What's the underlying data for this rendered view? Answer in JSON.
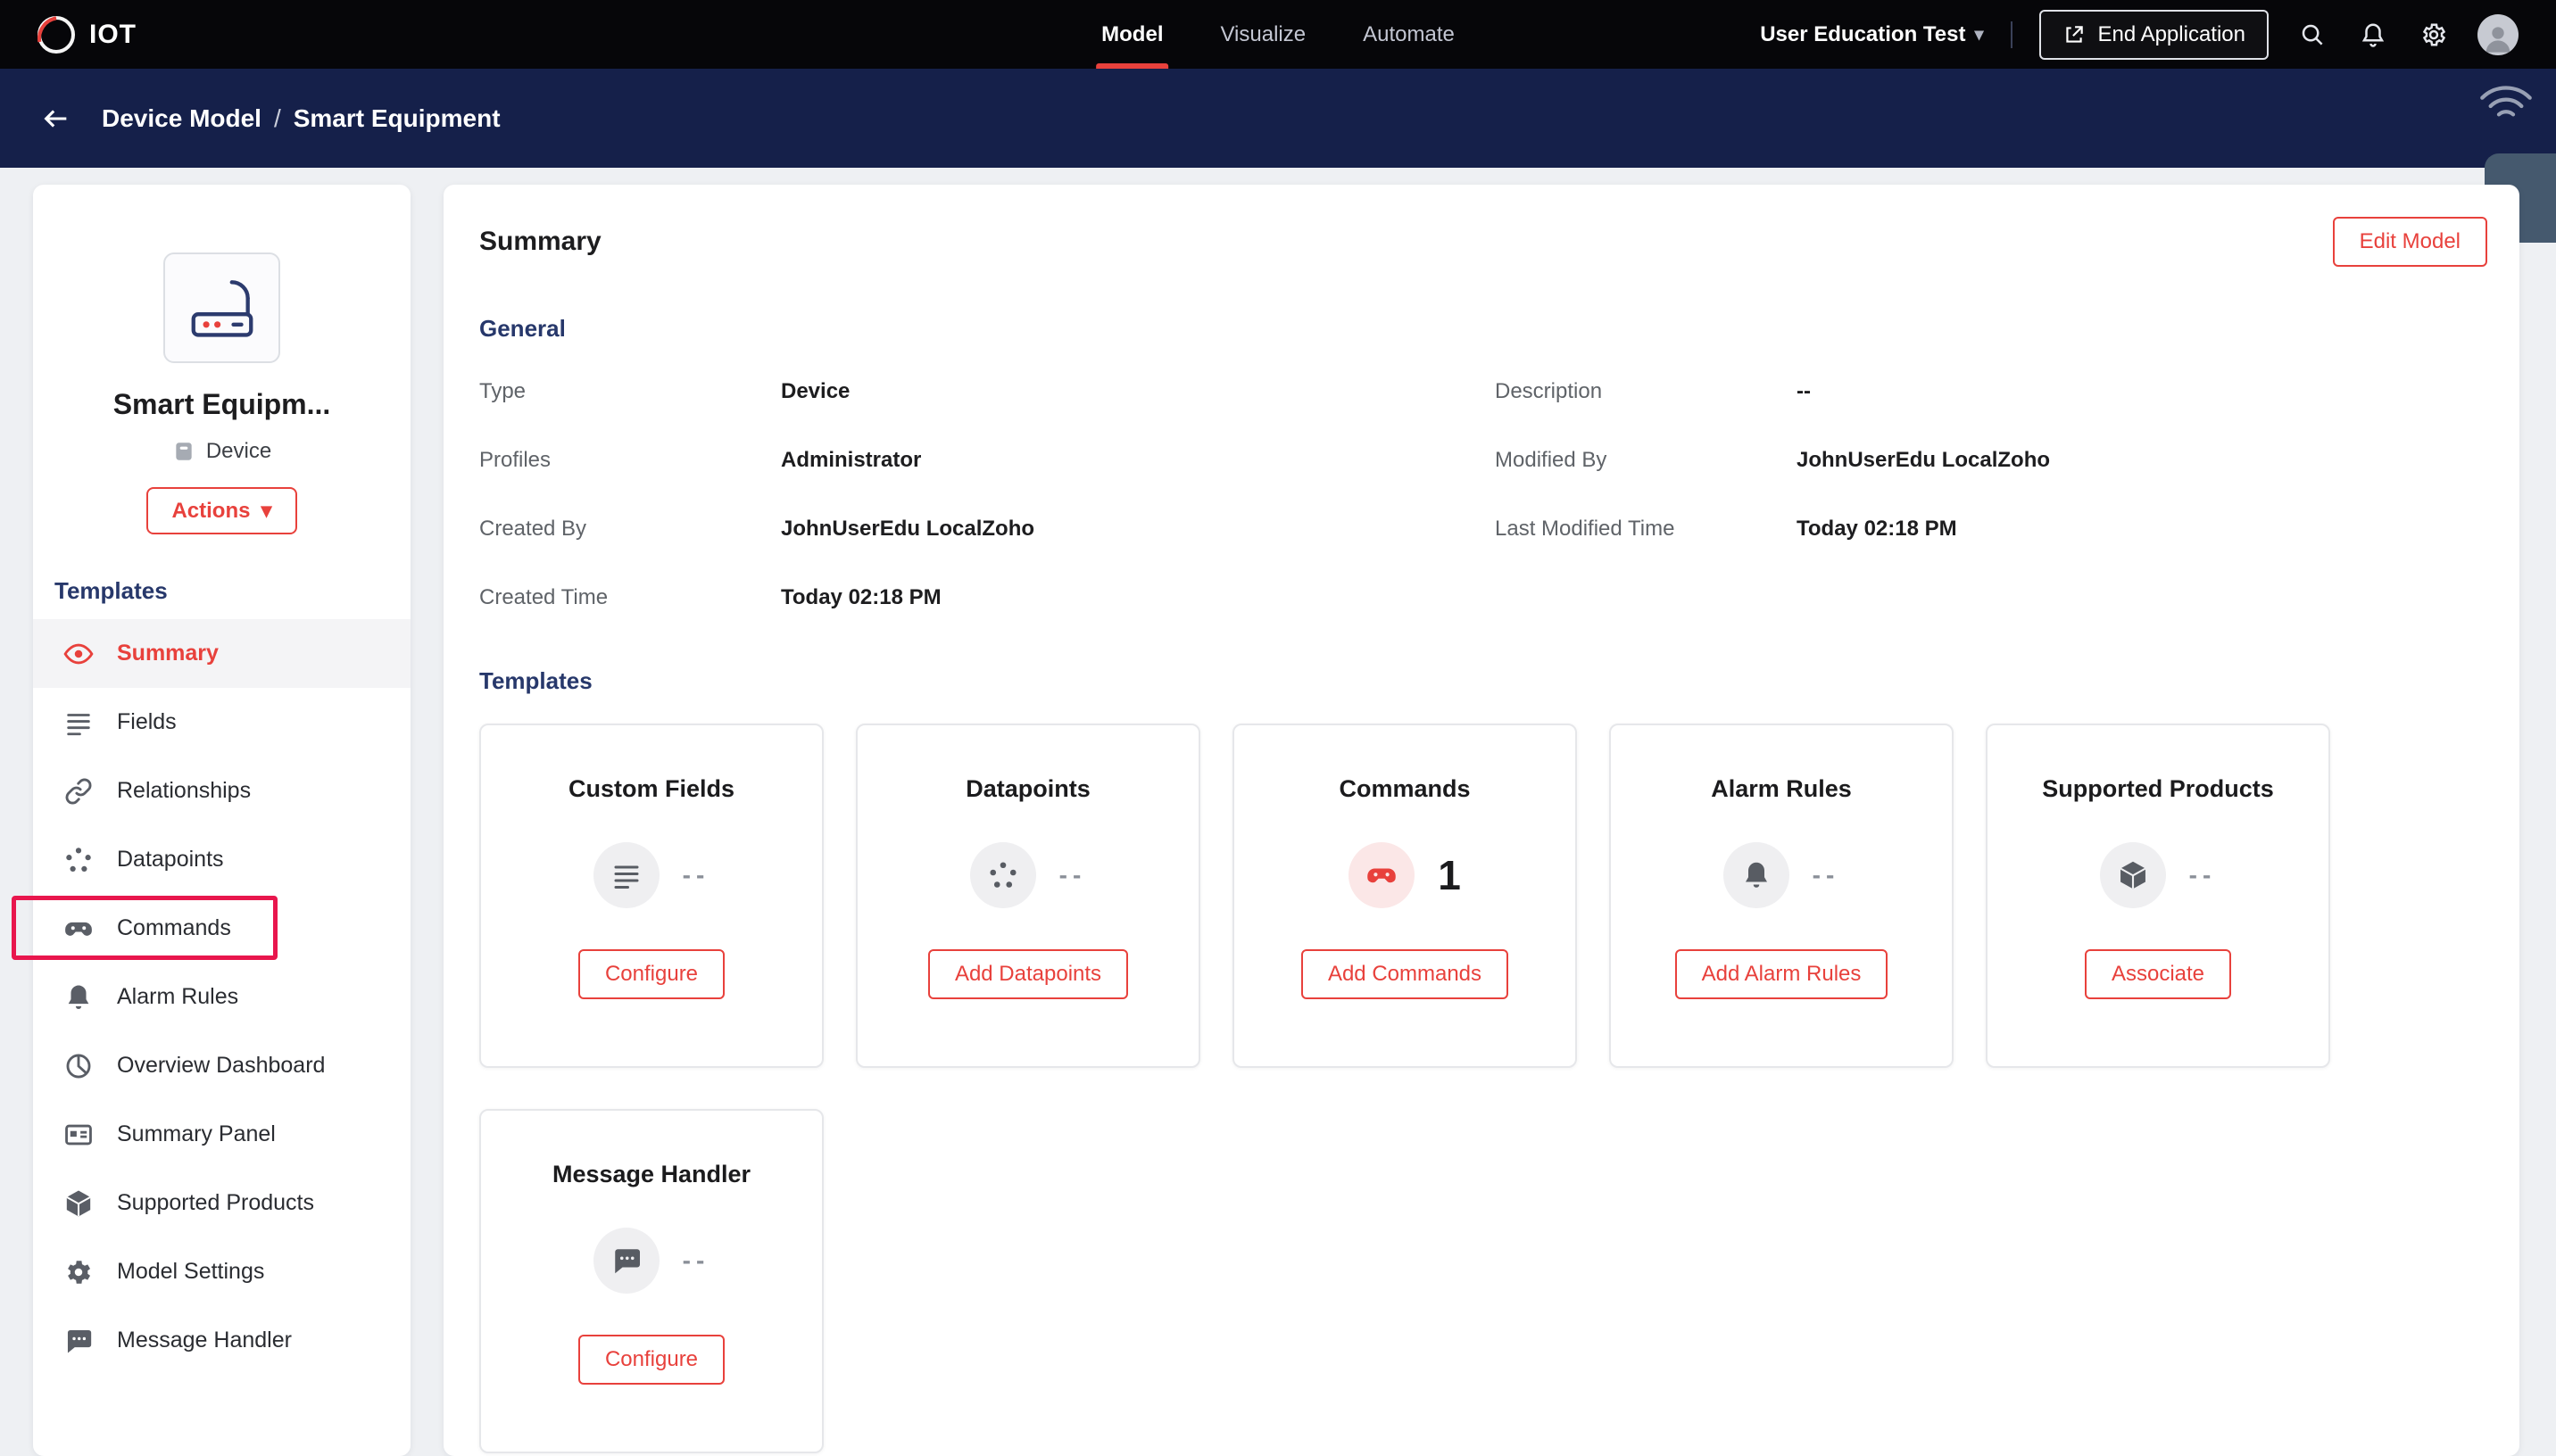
{
  "topnav": {
    "brand": "IOT",
    "tabs": [
      {
        "label": "Model"
      },
      {
        "label": "Visualize"
      },
      {
        "label": "Automate"
      }
    ],
    "org": "User Education Test",
    "end_application": "End Application"
  },
  "breadcrumb": {
    "parent": "Device Model",
    "separator": "/",
    "current": "Smart Equipment"
  },
  "sidebar": {
    "device_name": "Smart Equipm...",
    "device_type": "Device",
    "actions_label": "Actions",
    "templates_label": "Templates",
    "items": [
      {
        "label": "Summary"
      },
      {
        "label": "Fields"
      },
      {
        "label": "Relationships"
      },
      {
        "label": "Datapoints"
      },
      {
        "label": "Commands"
      },
      {
        "label": "Alarm Rules"
      },
      {
        "label": "Overview Dashboard"
      },
      {
        "label": "Summary Panel"
      },
      {
        "label": "Supported Products"
      },
      {
        "label": "Model Settings"
      },
      {
        "label": "Message Handler"
      }
    ]
  },
  "main": {
    "title": "Summary",
    "edit_button": "Edit Model",
    "general": {
      "heading": "General",
      "left": [
        {
          "label": "Type",
          "value": "Device"
        },
        {
          "label": "Profiles",
          "value": "Administrator"
        },
        {
          "label": "Created By",
          "value": "JohnUserEdu LocalZoho"
        },
        {
          "label": "Created Time",
          "value": "Today 02:18 PM"
        }
      ],
      "right": [
        {
          "label": "Description",
          "value": "--"
        },
        {
          "label": "Modified By",
          "value": "JohnUserEdu LocalZoho"
        },
        {
          "label": "Last Modified Time",
          "value": "Today 02:18 PM"
        }
      ]
    },
    "templates": {
      "heading": "Templates",
      "cards": [
        {
          "title": "Custom Fields",
          "count": "--",
          "button": "Configure"
        },
        {
          "title": "Datapoints",
          "count": "--",
          "button": "Add Datapoints"
        },
        {
          "title": "Commands",
          "count": "1",
          "button": "Add Commands"
        },
        {
          "title": "Alarm Rules",
          "count": "--",
          "button": "Add Alarm Rules"
        },
        {
          "title": "Supported Products",
          "count": "--",
          "button": "Associate"
        },
        {
          "title": "Message Handler",
          "count": "--",
          "button": "Configure"
        }
      ]
    }
  },
  "colors": {
    "accent_red": "#e8413c",
    "annotation_red": "#e8164d",
    "topbar_black": "#060609",
    "band_navy": "#15204a",
    "heading_navy": "#27386b"
  }
}
